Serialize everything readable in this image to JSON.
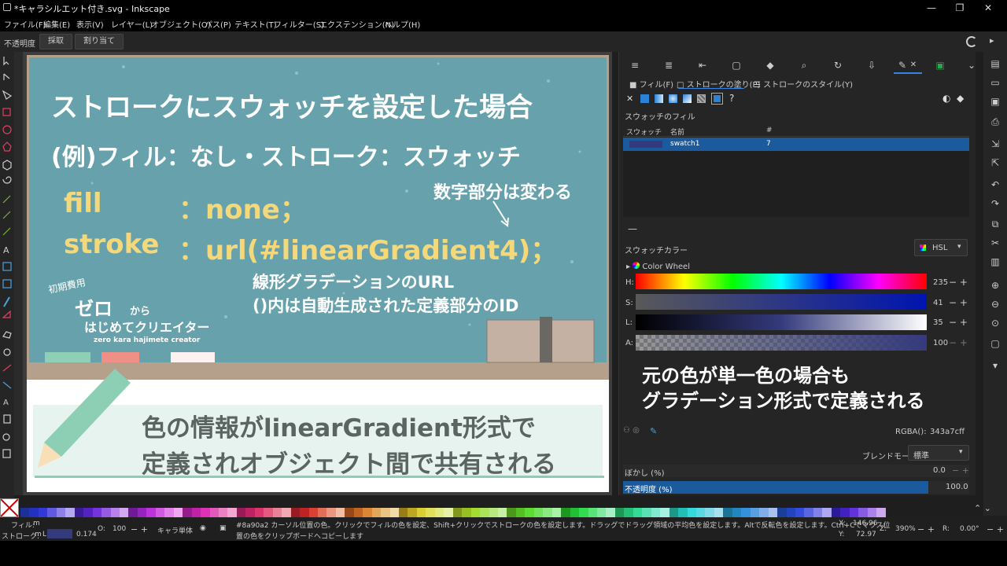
{
  "window": {
    "title": "*キャラシルエット付き.svg - Inkscape",
    "minimize": "—",
    "maximize": "❐",
    "close": "✕"
  },
  "menu": [
    "ファイル(F)",
    "編集(E)",
    "表示(V)",
    "レイヤー(L)",
    "オブジェクト(O)",
    "パス(P)",
    "テキスト(T)",
    "フィルター(S)",
    "エクステンション(N)",
    "ヘルプ(H)"
  ],
  "toolbar": {
    "label": "不透明度",
    "pick": "採取",
    "assign": "割り当て"
  },
  "slide": {
    "title": "ストロークにスウォッチを設定した場合",
    "example": "(例)フィル：なし・ストローク：スウォッチ",
    "fill_key": "fill",
    "fill_val": "：none；",
    "stroke_key": "stroke",
    "stroke_val": "：url(#linearGradient4)；",
    "note_number": "数字部分は変わる",
    "note_url1": "線形グラデーションのURL",
    "note_url2": "()内は自動生成された定義部分のID",
    "brand_small": "初期費用",
    "brand_zero": "ゼロ",
    "brand_kara": "から",
    "brand_line2": "はじめてクリエイター",
    "brand_roman": "zero kara hajimete creator",
    "bottom1": "色の情報がlinearGradient形式で",
    "bottom2": "定義されオブジェクト間で共有される"
  },
  "panel": {
    "tab_fill": "フィル(F)",
    "tab_stroke_paint": "ストロークの塗り(P)",
    "tab_stroke_style": "ストロークのスタイル(Y)",
    "swatch_fill_label": "スウォッチのフィル",
    "col_swatch": "スウォッチ",
    "col_name": "名前",
    "col_num": "#",
    "row_name": "swatch1",
    "row_num": "7",
    "row_color": "#343a7c",
    "swatch_color_label": "スウォッチカラー",
    "mode": "HSL",
    "color_wheel": "Color Wheel",
    "h_label": "H:",
    "h_val": "235",
    "s_label": "S:",
    "s_val": "41",
    "l_label": "L:",
    "l_val": "35",
    "a_label": "A:",
    "a_val": "100",
    "overlay1": "元の色が単一色の場合も",
    "overlay2": "グラデーション形式で定義される",
    "rgba_label": "RGBA():",
    "rgba_val": "343a7cff",
    "blend_label": "ブレンドモード:",
    "blend_val": "標準",
    "blur_label": "ぼかし (%)",
    "blur_val": "0.0",
    "opacity_label": "不透明度 (%)",
    "opacity_val": "100.0",
    "help": "?"
  },
  "status": {
    "fill_label": "フィル:",
    "fill_val": "m",
    "stroke_label": "ストローク:",
    "stroke_val": "m",
    "stroke_l": "L",
    "stroke_width": "0.174",
    "o_label": "O:",
    "o_val": "100",
    "layer": "キャラ単体",
    "message1": "#8a90a2 カーソル位置の色。クリックでフィルの色を設定、Shift+クリックでストロークの色を設定します。ドラッグでドラッグ領域の平均色を設定します。Altで反転色を設定します。Ctrl+Cでマウス位",
    "message2": "置の色をクリップボードへコピーします",
    "x_label": "X:",
    "x_val": "146.96",
    "y_label": "Y:",
    "y_val": "72.97",
    "z_label": "Z:",
    "zoom": "390%",
    "r_label": "R:",
    "rotation": "0.00°"
  },
  "colors": {
    "slide_bg": "#67a2ac",
    "accent_yellow": "#f5d879",
    "selection_blue": "#1c5a9e",
    "swatch": "#343a7c"
  }
}
